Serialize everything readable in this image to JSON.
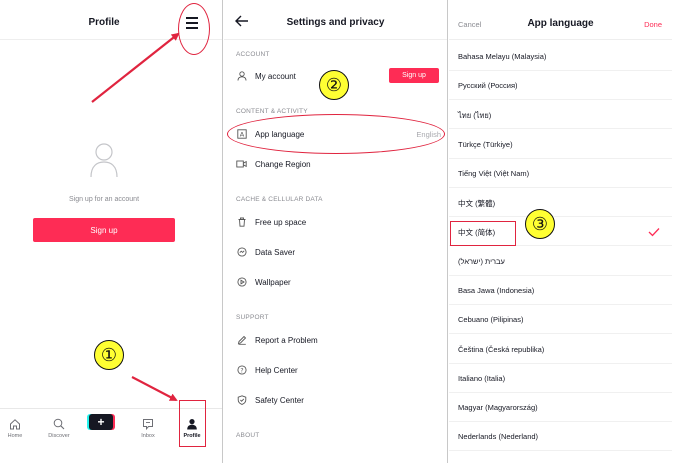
{
  "profile": {
    "title": "Profile",
    "signup_prompt": "Sign up for an account",
    "signup_button": "Sign up",
    "tabs": [
      {
        "label": "Home",
        "icon": "home-icon"
      },
      {
        "label": "Discover",
        "icon": "search-icon"
      },
      {
        "label": "Inbox",
        "icon": "inbox-icon"
      },
      {
        "label": "Profile",
        "icon": "person-icon"
      }
    ],
    "create_label": "+"
  },
  "settings": {
    "title": "Settings and privacy",
    "sections": {
      "account": "ACCOUNT",
      "content": "CONTENT & ACTIVITY",
      "cache": "CACHE & CELLULAR DATA",
      "support": "SUPPORT",
      "about": "ABOUT"
    },
    "my_account": "My account",
    "signup_button": "Sign up",
    "app_language": "App language",
    "app_language_value": "English",
    "change_region": "Change Region",
    "free_up_space": "Free up space",
    "data_saver": "Data Saver",
    "wallpaper": "Wallpaper",
    "report_problem": "Report a Problem",
    "help_center": "Help Center",
    "safety_center": "Safety Center"
  },
  "language": {
    "cancel": "Cancel",
    "title": "App language",
    "done": "Done",
    "items": [
      "Bahasa Melayu (Malaysia)",
      "Русский (Россия)",
      "ไทย (ไทย)",
      "Türkçe (Türkiye)",
      "Tiếng Việt (Việt Nam)",
      "中文 (繁體)",
      "中文 (简体)",
      "עברית (ישראל)",
      "Basa Jawa (Indonesia)",
      "Cebuano (Pilipinas)",
      "Čeština (Česká republika)",
      "Italiano (Italia)",
      "Magyar (Magyarország)",
      "Nederlands (Nederland)"
    ],
    "selected_index": 6
  },
  "steps": [
    "①",
    "②",
    "③"
  ],
  "colors": {
    "accent": "#fe2c55",
    "annotation": "#e0243f",
    "step_fill": "#ffff33"
  }
}
